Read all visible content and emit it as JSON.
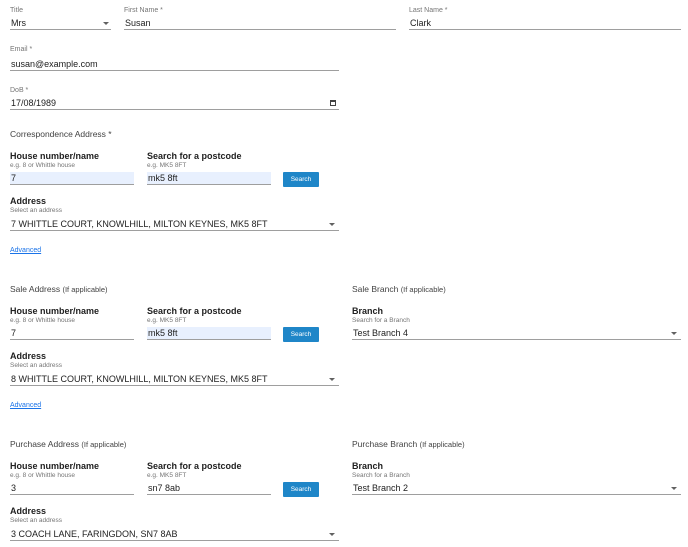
{
  "personal": {
    "title_label": "Title",
    "title_value": "Mrs",
    "first_name_label": "First Name *",
    "first_name_value": "Susan",
    "last_name_label": "Last Name *",
    "last_name_value": "Clark",
    "email_label": "Email *",
    "email_value": "susan@example.com",
    "dob_label": "DoB *",
    "dob_value": "17/08/1989"
  },
  "correspondence": {
    "heading": "Correspondence Address *",
    "house_label": "House number/name",
    "house_hint": "e.g. 8 or Whittle house",
    "house_value": "7",
    "postcode_label": "Search for a postcode",
    "postcode_hint": "e.g. MK5 8FT",
    "postcode_value": "mk5 8ft",
    "search_button": "Search",
    "address_label": "Address",
    "address_hint": "Select an address",
    "address_value": "7 WHITTLE COURT, KNOWLHILL, MILTON KEYNES, MK5 8FT",
    "advanced_link": "Advanced"
  },
  "sale": {
    "heading": "Sale Address",
    "heading_suffix": "(If applicable)",
    "house_label": "House number/name",
    "house_hint": "e.g. 8 or Whittle house",
    "house_value": "7",
    "postcode_label": "Search for a postcode",
    "postcode_hint": "e.g. MK5 8FT",
    "postcode_value": "mk5 8ft",
    "search_button": "Search",
    "address_label": "Address",
    "address_hint": "Select an address",
    "address_value": "8 WHITTLE COURT, KNOWLHILL, MILTON KEYNES, MK5 8FT",
    "advanced_link": "Advanced",
    "branch_heading": "Sale Branch",
    "branch_heading_suffix": "(If applicable)",
    "branch_label": "Branch",
    "branch_hint": "Search for a Branch",
    "branch_value": "Test Branch 4"
  },
  "purchase": {
    "heading": "Purchase Address",
    "heading_suffix": "(If applicable)",
    "house_label": "House number/name",
    "house_hint": "e.g. 8 or Whittle house",
    "house_value": "3",
    "postcode_label": "Search for a postcode",
    "postcode_hint": "e.g. MK5 8FT",
    "postcode_value": "sn7 8ab",
    "search_button": "Search",
    "address_label": "Address",
    "address_hint": "Select an address",
    "address_value": "3 COACH LANE, FARINGDON, SN7 8AB",
    "branch_heading": "Purchase Branch",
    "branch_heading_suffix": "(If applicable)",
    "branch_label": "Branch",
    "branch_hint": "Search for a Branch",
    "branch_value": "Test Branch 2"
  },
  "colors": {
    "accent": "#1f86c8",
    "autofill": "#e8f0fe",
    "link": "#1a73e8"
  }
}
